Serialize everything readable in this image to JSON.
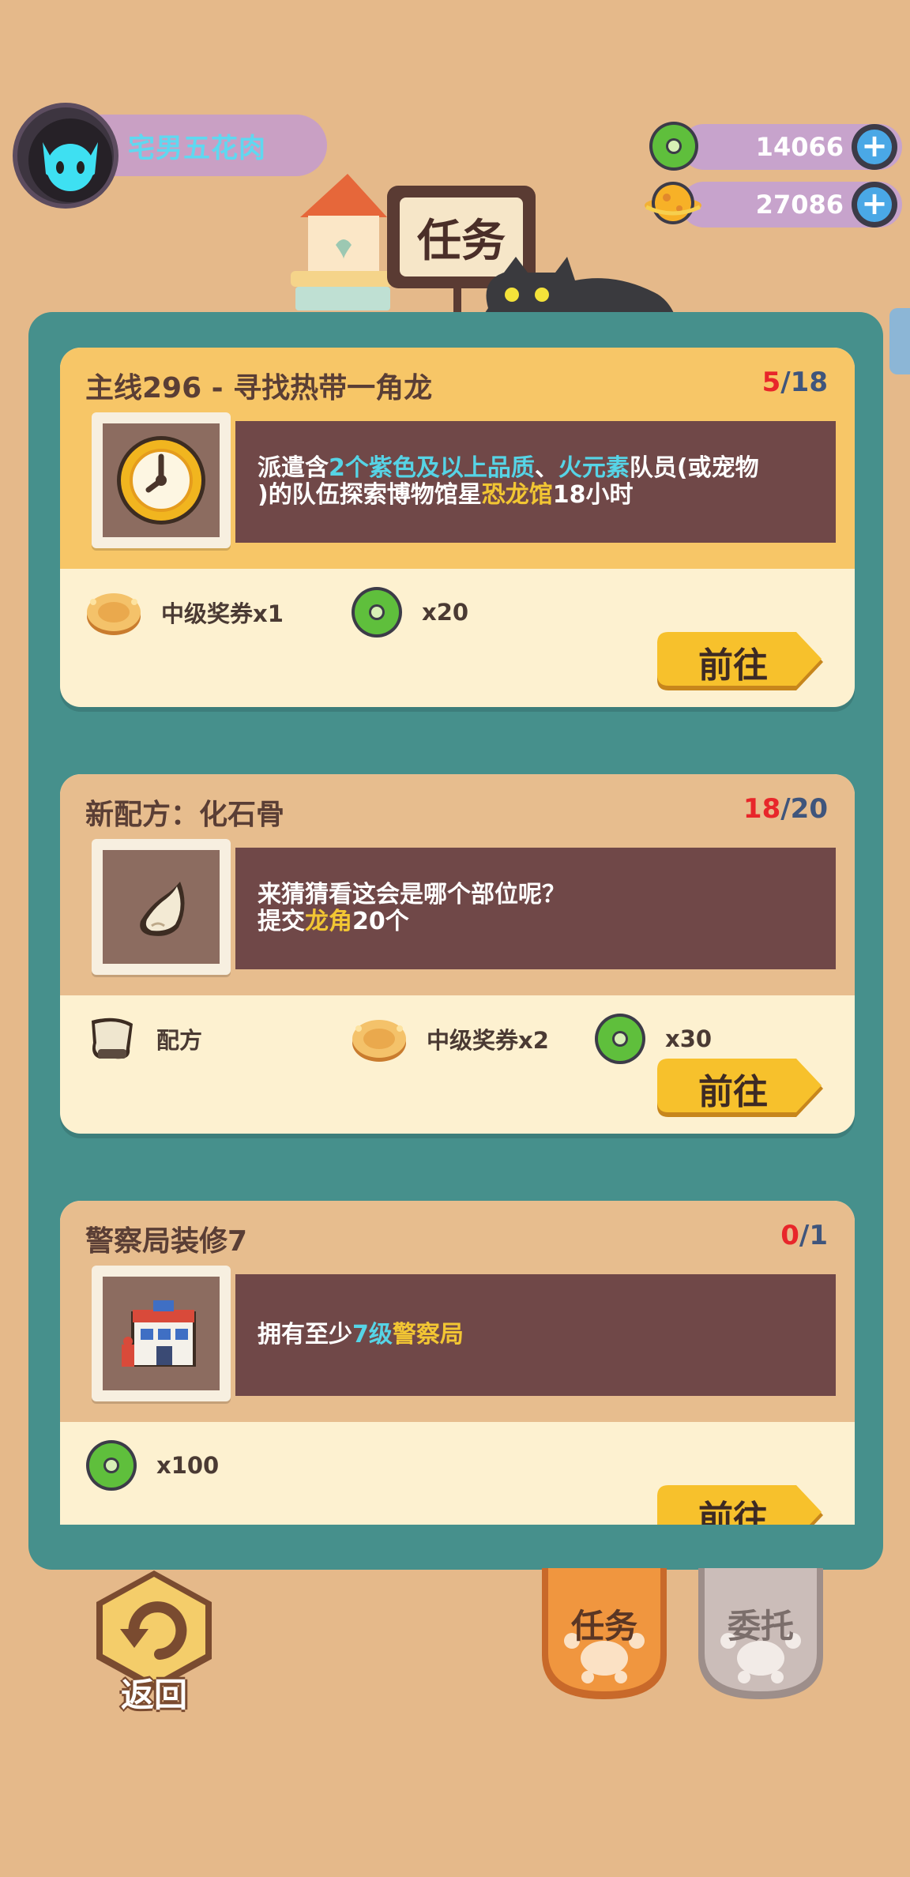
{
  "player": {
    "name": "宅男五花肉"
  },
  "currency": [
    {
      "name": "green-donut",
      "value": "14066"
    },
    {
      "name": "gold-coin",
      "value": "27086"
    }
  ],
  "header": {
    "title": "任务"
  },
  "quests": [
    {
      "title": "主线296 - 寻找热带一角龙",
      "progress_current": "5",
      "progress_sep": "/",
      "progress_total": "18",
      "icon": "compass-icon",
      "desc": [
        [
          {
            "t": "派遣含",
            "c": ""
          },
          {
            "t": "2个紫色及以上品质",
            "c": "cyan"
          },
          {
            "t": "、",
            "c": ""
          },
          {
            "t": "火元素",
            "c": "cyan"
          },
          {
            "t": "队员(或宠物",
            "c": ""
          }
        ],
        [
          {
            "t": ")的队伍探索博物馆星",
            "c": ""
          },
          {
            "t": "恐龙馆",
            "c": "yellow"
          },
          {
            "t": "18小时",
            "c": ""
          }
        ]
      ],
      "rewards": [
        {
          "icon": "voucher-icon",
          "label": "中级奖券x1"
        },
        {
          "icon": "donut-icon",
          "label": "x20"
        }
      ],
      "button": "前往"
    },
    {
      "title": "新配方：化石骨",
      "progress_current": "18",
      "progress_sep": "/",
      "progress_total": "20",
      "icon": "fossil-bone-icon",
      "desc": [
        [
          {
            "t": "来猜猜看这会是哪个部位呢？",
            "c": ""
          }
        ],
        [
          {
            "t": "提交",
            "c": ""
          },
          {
            "t": "龙角",
            "c": "yellow"
          },
          {
            "t": "20个",
            "c": ""
          }
        ]
      ],
      "rewards": [
        {
          "icon": "recipe-icon",
          "label": "配方"
        },
        {
          "icon": "voucher-icon",
          "label": "中级奖券x2"
        },
        {
          "icon": "donut-icon",
          "label": "x30"
        }
      ],
      "button": "前往"
    },
    {
      "title": "警察局装修7",
      "progress_current": "0",
      "progress_sep": "/",
      "progress_total": "1",
      "icon": "police-station-icon",
      "desc": [
        [
          {
            "t": "拥有至少",
            "c": ""
          },
          {
            "t": "7级",
            "c": "cyan"
          },
          {
            "t": "警察局",
            "c": "yellow"
          }
        ]
      ],
      "rewards": [
        {
          "icon": "donut-icon",
          "label": "x100"
        }
      ],
      "button": "前往"
    }
  ],
  "nav": {
    "back": "返回",
    "tab_quest": "任务",
    "tab_commission": "委托"
  },
  "colors": {
    "background": "#e5b98a",
    "panel": "#46908c",
    "card": "#fdf1d0",
    "main_quest_header": "#f7c667",
    "quest_header": "#e7bd8e",
    "desc_bg": "#704848",
    "highlight_cyan": "#56d4e6",
    "highlight_yellow": "#f2c633",
    "progress_red": "#e8262a",
    "button_yellow": "#f7c12c"
  }
}
